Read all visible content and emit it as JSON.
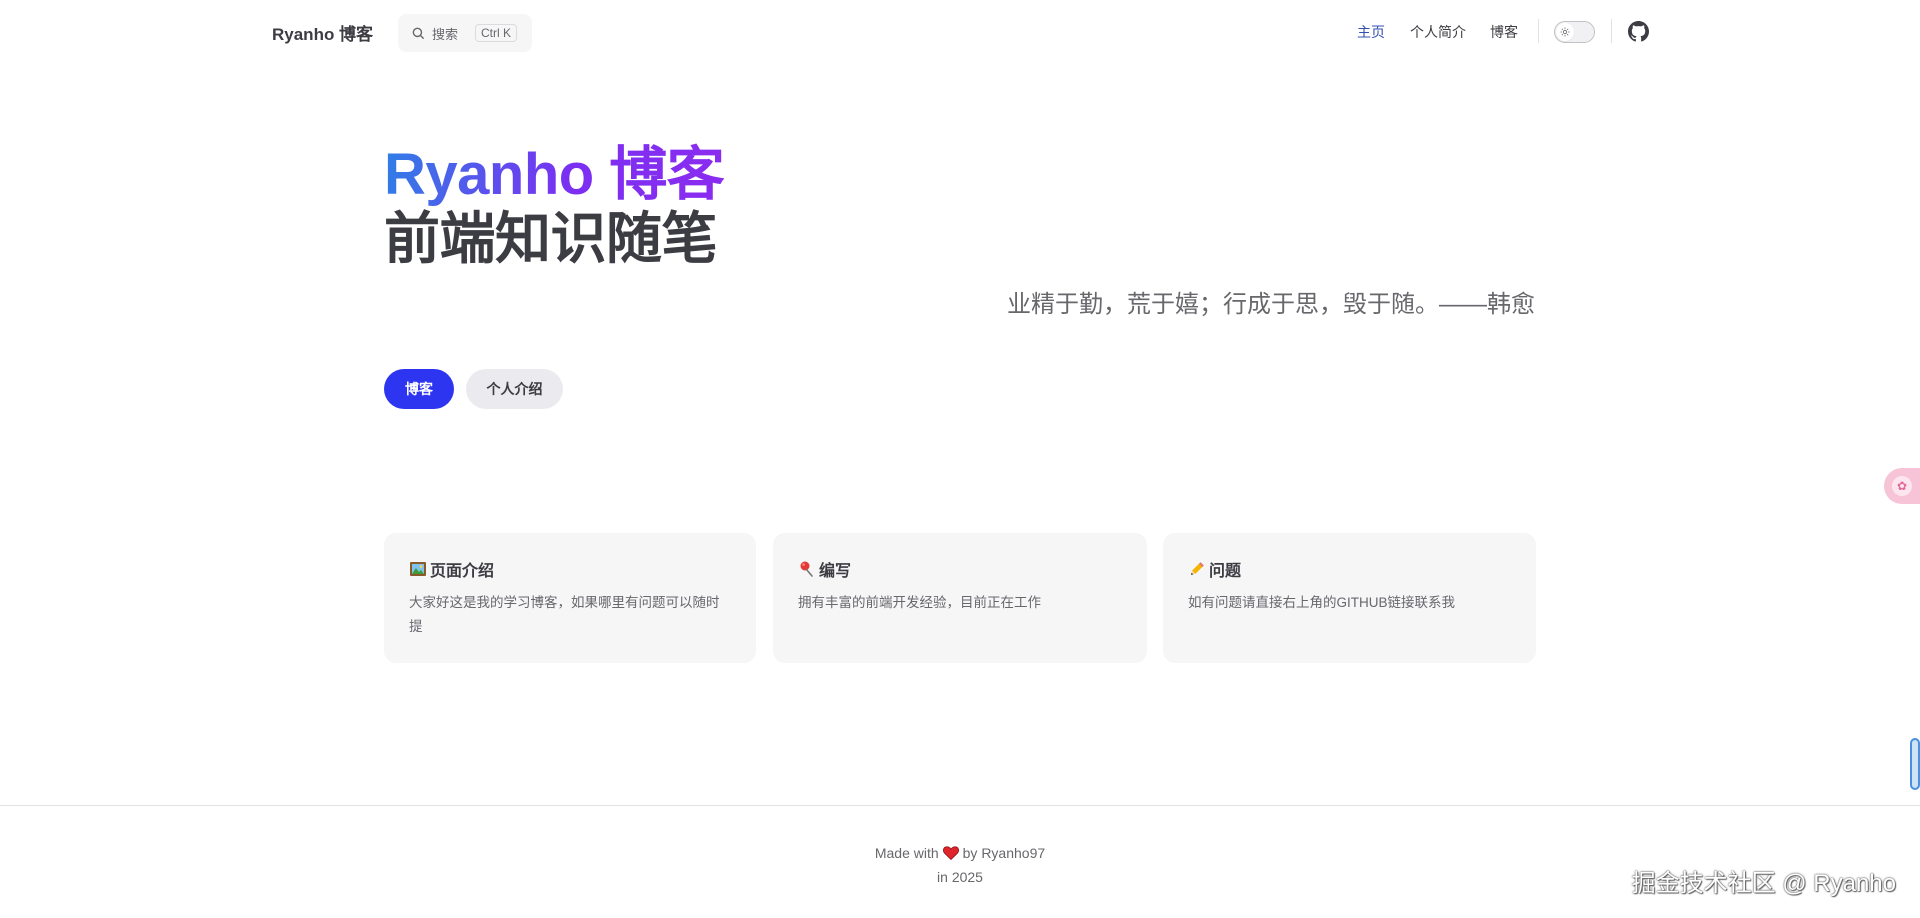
{
  "nav": {
    "brand": "Ryanho 博客",
    "search_placeholder": "搜索",
    "search_shortcut": "Ctrl K",
    "items": [
      {
        "label": "主页",
        "active": true
      },
      {
        "label": "个人简介",
        "active": false
      },
      {
        "label": "博客",
        "active": false
      }
    ],
    "icons": {
      "search": "search-icon",
      "theme": "sun-icon",
      "social": "github-icon"
    }
  },
  "hero": {
    "name": "Ryanho 博客",
    "text": "前端知识随笔",
    "tagline": "业精于勤，荒于嬉；行成于思，毁于随。——韩愈",
    "actions": [
      {
        "label": "博客",
        "theme": "brand"
      },
      {
        "label": "个人介绍",
        "theme": "alt"
      }
    ]
  },
  "features": [
    {
      "icon": "framed-picture-icon",
      "title": "页面介绍",
      "details": "大家好这是我的学习博客，如果哪里有问题可以随时提"
    },
    {
      "icon": "pushpin-icon",
      "title": "编写",
      "details": "拥有丰富的前端开发经验，目前正在工作"
    },
    {
      "icon": "pencil-icon",
      "title": "问题",
      "details": "如有问题请直接右上角的GITHUB链接联系我"
    }
  ],
  "footer": {
    "made_with": "Made with",
    "by": "by Ryanho97",
    "year": "in 2025"
  },
  "watermark": "掘金技术社区 @ Ryanho",
  "colors": {
    "brand": "#2d35f0",
    "nav_active": "#3451b2",
    "text": "#3c3c43",
    "muted": "#67676c",
    "card_bg": "#f6f6f7",
    "gradient_start": "#2f7fe6",
    "gradient_end": "#8b2cf0"
  }
}
